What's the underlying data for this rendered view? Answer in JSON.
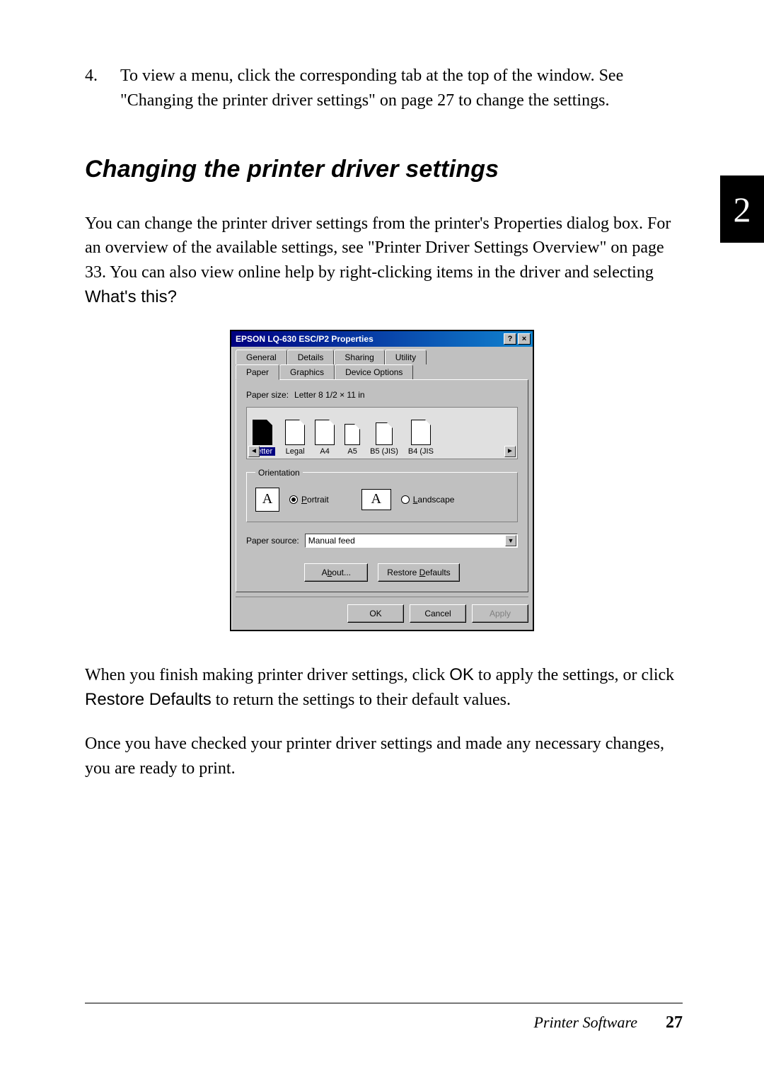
{
  "step": {
    "number": "4.",
    "text_a": "To view a menu, click the corresponding tab at the top of the window. See \"Changing the printer driver settings\" on page 27 to change the settings."
  },
  "side_tab": "2",
  "heading": "Changing the printer driver settings",
  "intro": {
    "part1": "You can change the printer driver settings from the printer's Properties dialog box. For an overview of the available settings, see \"Printer Driver Settings Overview\" on page 33. You can also view online help by right-clicking items in the driver and selecting ",
    "whats_this": "What's this?"
  },
  "dialog": {
    "title": "EPSON LQ-630 ESC/P2 Properties",
    "help_btn": "?",
    "close_btn": "×",
    "tabs_back": [
      "General",
      "Details",
      "Sharing",
      "Utility"
    ],
    "tabs_front": [
      "Paper",
      "Graphics",
      "Device Options"
    ],
    "paper_size_label": "Paper size:",
    "paper_size_value": "Letter 8 1/2 × 11 in",
    "papers": [
      "Letter",
      "Legal",
      "A4",
      "A5",
      "B5 (JIS)",
      "B4 (JIS"
    ],
    "orientation_legend": "Orientation",
    "portrait": "Portrait",
    "landscape": "Landscape",
    "paper_source_label": "Paper source:",
    "paper_source_value": "Manual feed",
    "about_btn": "About...",
    "restore_btn": "Restore Defaults",
    "ok_btn": "OK",
    "cancel_btn": "Cancel",
    "apply_btn": "Apply"
  },
  "outro1": {
    "a": "When you finish making printer driver settings, click ",
    "ok": "OK",
    "b": " to apply the settings, or click ",
    "rd": "Restore Defaults",
    "c": " to return the settings to their default values."
  },
  "outro2": "Once you have checked your printer driver settings and made any necessary changes, you are ready to print.",
  "footer": {
    "title": "Printer Software",
    "page": "27"
  }
}
